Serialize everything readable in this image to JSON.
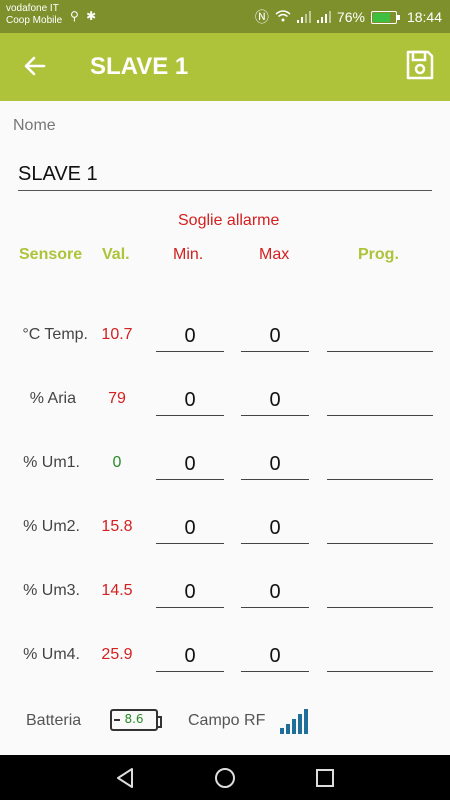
{
  "status_bar": {
    "carrier_line1": "vodafone IT",
    "carrier_line2": "Coop Mobile",
    "battery_pct": "76%",
    "time": "18:44",
    "icons": [
      "usb-icon",
      "debug-icon",
      "nfc-icon",
      "wifi-icon",
      "signal-icon",
      "signal-icon",
      "battery-icon"
    ]
  },
  "app_bar": {
    "title": "SLAVE 1",
    "back_icon": "arrow-left-icon",
    "save_icon": "save-icon"
  },
  "form": {
    "nome_label": "Nome",
    "nome_value": "SLAVE 1",
    "soglie_label": "Soglie allarme",
    "headers": {
      "sensore": "Sensore",
      "val": "Val.",
      "min": "Min.",
      "max": "Max",
      "prog": "Prog."
    },
    "rows": [
      {
        "label": "°C Temp.",
        "value": "10.7",
        "value_color": "#d32020",
        "min": "0",
        "max": "0",
        "prog": ""
      },
      {
        "label": "% Aria",
        "value": "79",
        "value_color": "#d32020",
        "min": "0",
        "max": "0",
        "prog": ""
      },
      {
        "label": "% Um1.",
        "value": "0",
        "value_color": "#2a8a2a",
        "min": "0",
        "max": "0",
        "prog": ""
      },
      {
        "label": "% Um2.",
        "value": "15.8",
        "value_color": "#d32020",
        "min": "0",
        "max": "0",
        "prog": ""
      },
      {
        "label": "% Um3.",
        "value": "14.5",
        "value_color": "#d32020",
        "min": "0",
        "max": "0",
        "prog": ""
      },
      {
        "label": "% Um4.",
        "value": "25.9",
        "value_color": "#d32020",
        "min": "0",
        "max": "0",
        "prog": ""
      }
    ]
  },
  "footer": {
    "batteria_label": "Batteria",
    "battery_voltage": "8.6",
    "campo_rf_label": "Campo RF",
    "rf_icon": "signal-bars-icon"
  },
  "nav_bar": {
    "icons": [
      "back-triangle-icon",
      "home-circle-icon",
      "recents-square-icon"
    ]
  },
  "colors": {
    "accent": "#aec33a",
    "status_bar": "#7e902c",
    "alarm_red": "#d32020",
    "ok_green": "#2a8a2a"
  }
}
